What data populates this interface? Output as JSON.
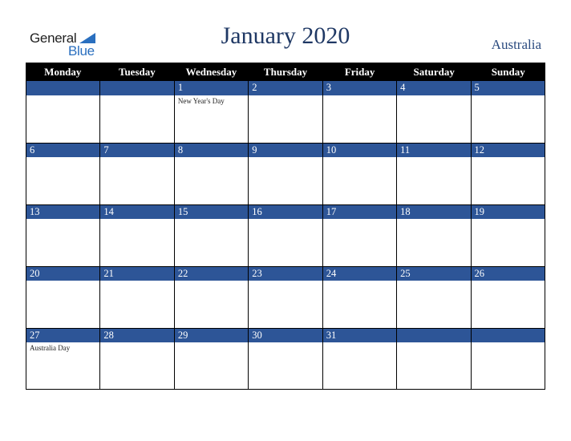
{
  "logo": {
    "word1": "General",
    "word2": "Blue",
    "icon": "triangle-flag-icon"
  },
  "header": {
    "title": "January 2020",
    "country": "Australia"
  },
  "colors": {
    "accent": "#2d5597",
    "header_bg": "#000000",
    "title": "#1f3864"
  },
  "weekdays": [
    "Monday",
    "Tuesday",
    "Wednesday",
    "Thursday",
    "Friday",
    "Saturday",
    "Sunday"
  ],
  "weeks": [
    [
      {
        "day": "",
        "holiday": ""
      },
      {
        "day": "",
        "holiday": ""
      },
      {
        "day": "1",
        "holiday": "New Year's Day"
      },
      {
        "day": "2",
        "holiday": ""
      },
      {
        "day": "3",
        "holiday": ""
      },
      {
        "day": "4",
        "holiday": ""
      },
      {
        "day": "5",
        "holiday": ""
      }
    ],
    [
      {
        "day": "6",
        "holiday": ""
      },
      {
        "day": "7",
        "holiday": ""
      },
      {
        "day": "8",
        "holiday": ""
      },
      {
        "day": "9",
        "holiday": ""
      },
      {
        "day": "10",
        "holiday": ""
      },
      {
        "day": "11",
        "holiday": ""
      },
      {
        "day": "12",
        "holiday": ""
      }
    ],
    [
      {
        "day": "13",
        "holiday": ""
      },
      {
        "day": "14",
        "holiday": ""
      },
      {
        "day": "15",
        "holiday": ""
      },
      {
        "day": "16",
        "holiday": ""
      },
      {
        "day": "17",
        "holiday": ""
      },
      {
        "day": "18",
        "holiday": ""
      },
      {
        "day": "19",
        "holiday": ""
      }
    ],
    [
      {
        "day": "20",
        "holiday": ""
      },
      {
        "day": "21",
        "holiday": ""
      },
      {
        "day": "22",
        "holiday": ""
      },
      {
        "day": "23",
        "holiday": ""
      },
      {
        "day": "24",
        "holiday": ""
      },
      {
        "day": "25",
        "holiday": ""
      },
      {
        "day": "26",
        "holiday": ""
      }
    ],
    [
      {
        "day": "27",
        "holiday": "Australia Day"
      },
      {
        "day": "28",
        "holiday": ""
      },
      {
        "day": "29",
        "holiday": ""
      },
      {
        "day": "30",
        "holiday": ""
      },
      {
        "day": "31",
        "holiday": ""
      },
      {
        "day": "",
        "holiday": ""
      },
      {
        "day": "",
        "holiday": ""
      }
    ]
  ]
}
